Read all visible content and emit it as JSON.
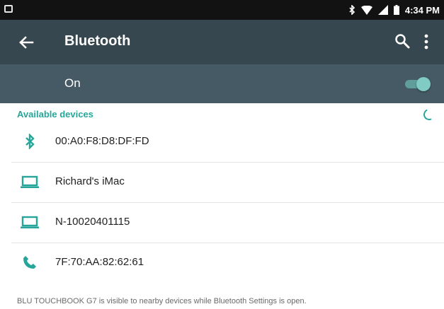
{
  "status_bar": {
    "time": "4:34 PM",
    "icons": [
      "notification-icon",
      "bluetooth-icon",
      "wifi-icon",
      "signal-icon",
      "battery-icon"
    ]
  },
  "app_bar": {
    "title": "Bluetooth",
    "icons": [
      "back-arrow-icon",
      "search-icon",
      "more-options-icon"
    ]
  },
  "toggle": {
    "label": "On",
    "state": true
  },
  "section": {
    "title": "Available devices"
  },
  "devices": [
    {
      "name": "00:A0:F8:D8:DF:FD",
      "icon": "bluetooth-icon"
    },
    {
      "name": "Richard's iMac",
      "icon": "laptop-icon"
    },
    {
      "name": "N-10020401115",
      "icon": "laptop-icon"
    },
    {
      "name": "7F:70:AA:82:62:61",
      "icon": "phone-icon"
    }
  ],
  "footer": {
    "text": "BLU TOUCHBOOK G7 is visible to nearby devices while Bluetooth Settings is open."
  },
  "colors": {
    "status_bar": "#121212",
    "app_bar": "#37474f",
    "toggle_bar": "#455a64",
    "accent": "#26a69a"
  }
}
